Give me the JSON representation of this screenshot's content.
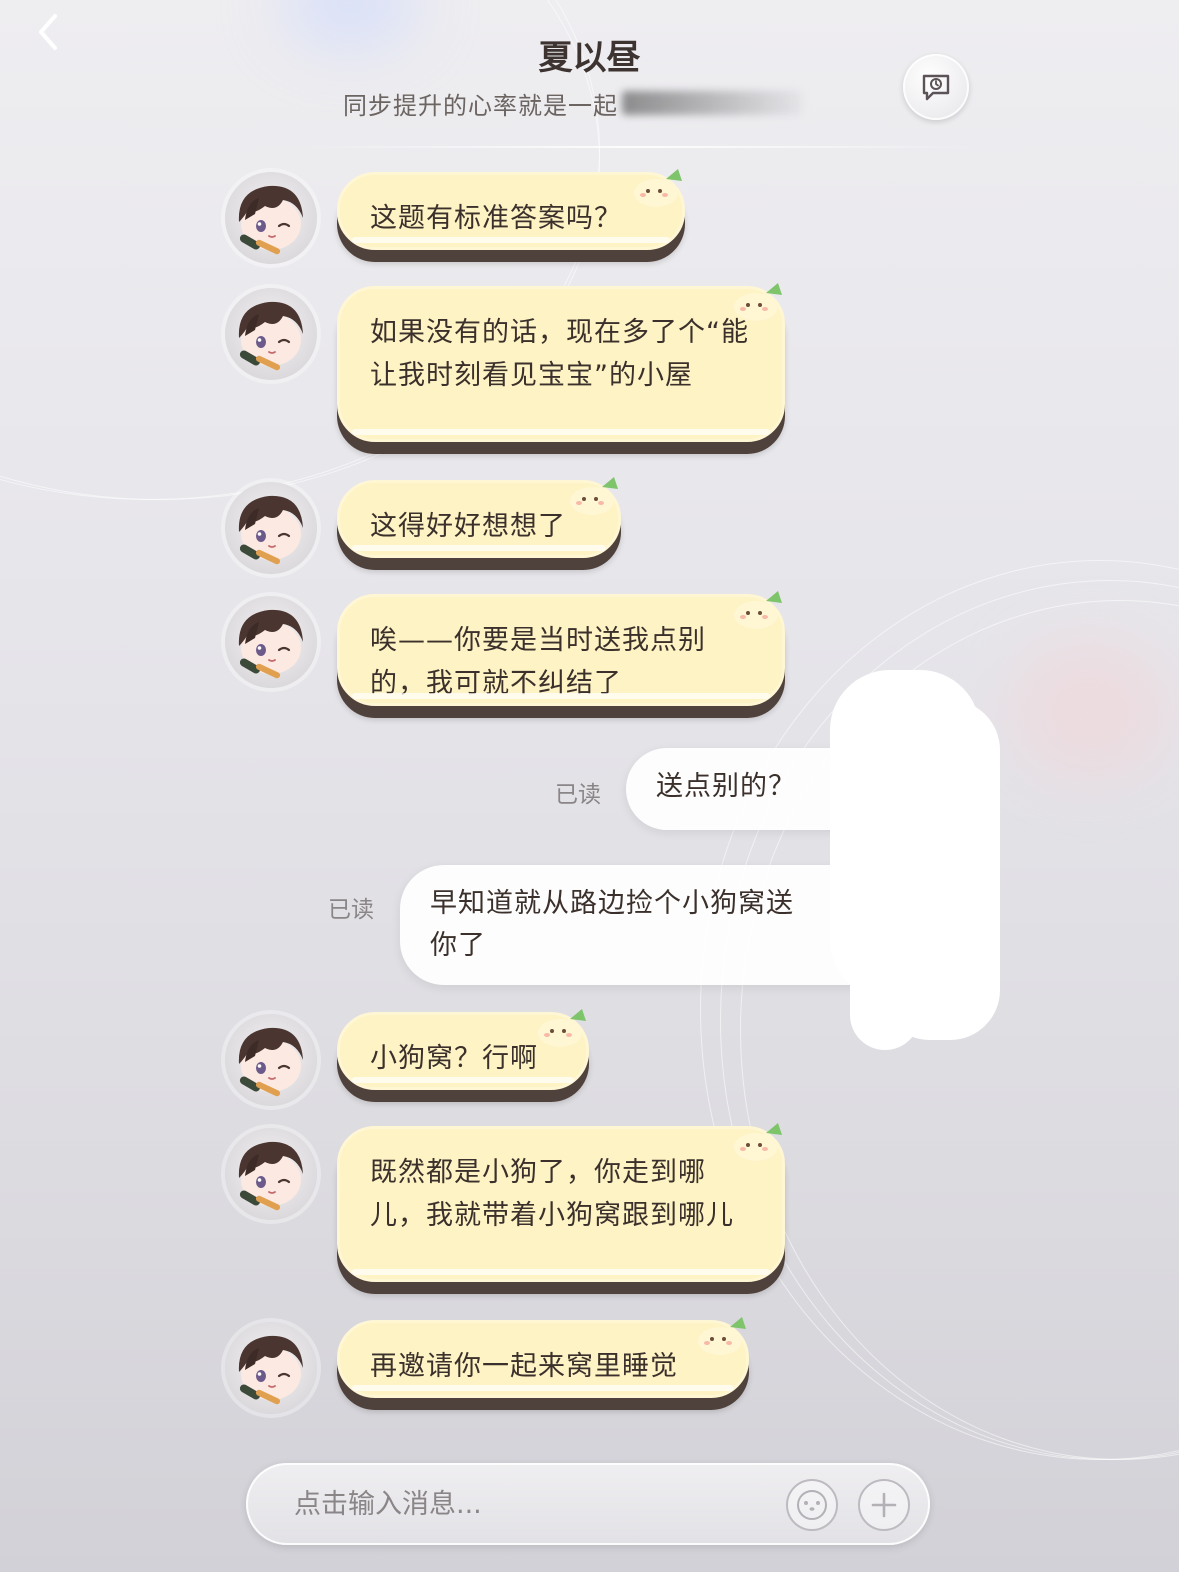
{
  "header": {
    "title": "夏以昼",
    "subtitle": "同步提升的心率就是一起",
    "back_icon": "chevron-left-icon",
    "history_icon": "chat-history-icon"
  },
  "messages": [
    {
      "sender": "contact",
      "text": "这题有标准答案吗？"
    },
    {
      "sender": "contact",
      "text": "如果没有的话，现在多了个“能让我时刻看见宝宝”的小屋"
    },
    {
      "sender": "contact",
      "text": "这得好好想想了"
    },
    {
      "sender": "contact",
      "text": "唉——你要是当时送我点别的，我可就不纠结了"
    },
    {
      "sender": "me",
      "text": "送点别的？",
      "status": "已读"
    },
    {
      "sender": "me",
      "text": "早知道就从路边捡个小狗窝送你了",
      "status": "已读"
    },
    {
      "sender": "contact",
      "text": "小狗窝？行啊"
    },
    {
      "sender": "contact",
      "text": "既然都是小狗了，你走到哪儿，我就带着小狗窝跟到哪儿"
    },
    {
      "sender": "contact",
      "text": "再邀请你一起来窝里睡觉"
    }
  ],
  "input": {
    "placeholder": "点击输入消息...",
    "emoji_icon": "emoji-face-icon",
    "add_icon": "plus-icon"
  },
  "colors": {
    "incoming_bubble": "#fdf3c4",
    "incoming_shadow": "#4f413b",
    "outgoing_bubble": "#ffffff",
    "background": "#e6e5ea"
  }
}
